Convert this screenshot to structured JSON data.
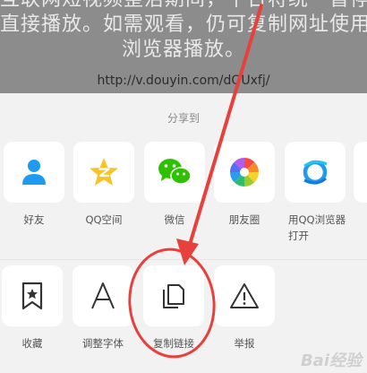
{
  "background_text": {
    "lines": [
      "互联网短视频整治期间，平台将统一暂停",
      "直接播放。如需观看，仍可复制网址使用",
      "浏览器播放。"
    ],
    "url": "http://v.douyin.com/dQUxfj/"
  },
  "share_sheet": {
    "title": "分享到",
    "row1": [
      {
        "label": "好友",
        "icon": "person-icon"
      },
      {
        "label": "QQ空间",
        "icon": "qzone-star-icon"
      },
      {
        "label": "微信",
        "icon": "wechat-icon"
      },
      {
        "label": "朋友圈",
        "icon": "moments-aperture-icon"
      },
      {
        "label": "用QQ浏览器打开",
        "icon": "qq-browser-icon"
      }
    ],
    "row2": [
      {
        "label": "收藏",
        "icon": "bookmark-star-icon"
      },
      {
        "label": "调整字体",
        "icon": "font-a-icon"
      },
      {
        "label": "复制链接",
        "icon": "copy-icon"
      },
      {
        "label": "举报",
        "icon": "warning-triangle-icon"
      }
    ]
  },
  "watermark": "Bai经验",
  "colors": {
    "annotation_red": "#e8403a",
    "qq_blue": "#1e9bf0",
    "wechat_green": "#2dc100",
    "qzone_yellow": "#f7c326"
  }
}
